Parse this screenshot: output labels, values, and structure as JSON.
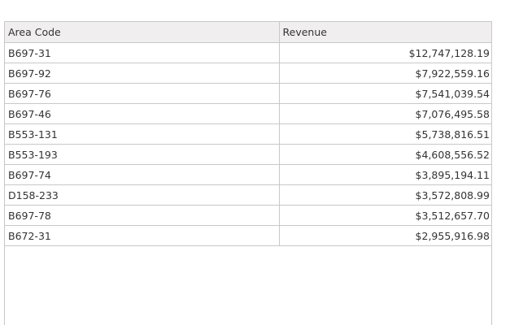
{
  "table": {
    "columns": [
      "Area Code",
      "Revenue"
    ],
    "rows": [
      [
        "B697-31",
        "$12,747,128.19"
      ],
      [
        "B697-92",
        "$7,922,559.16"
      ],
      [
        "B697-76",
        "$7,541,039.54"
      ],
      [
        "B697-46",
        "$7,076,495.58"
      ],
      [
        "B553-131",
        "$5,738,816.51"
      ],
      [
        "B553-193",
        "$4,608,556.52"
      ],
      [
        "B697-74",
        "$3,895,194.11"
      ],
      [
        "D158-233",
        "$3,572,808.99"
      ],
      [
        "B697-78",
        "$3,512,657.70"
      ],
      [
        "B672-31",
        "$2,955,916.98"
      ]
    ]
  }
}
